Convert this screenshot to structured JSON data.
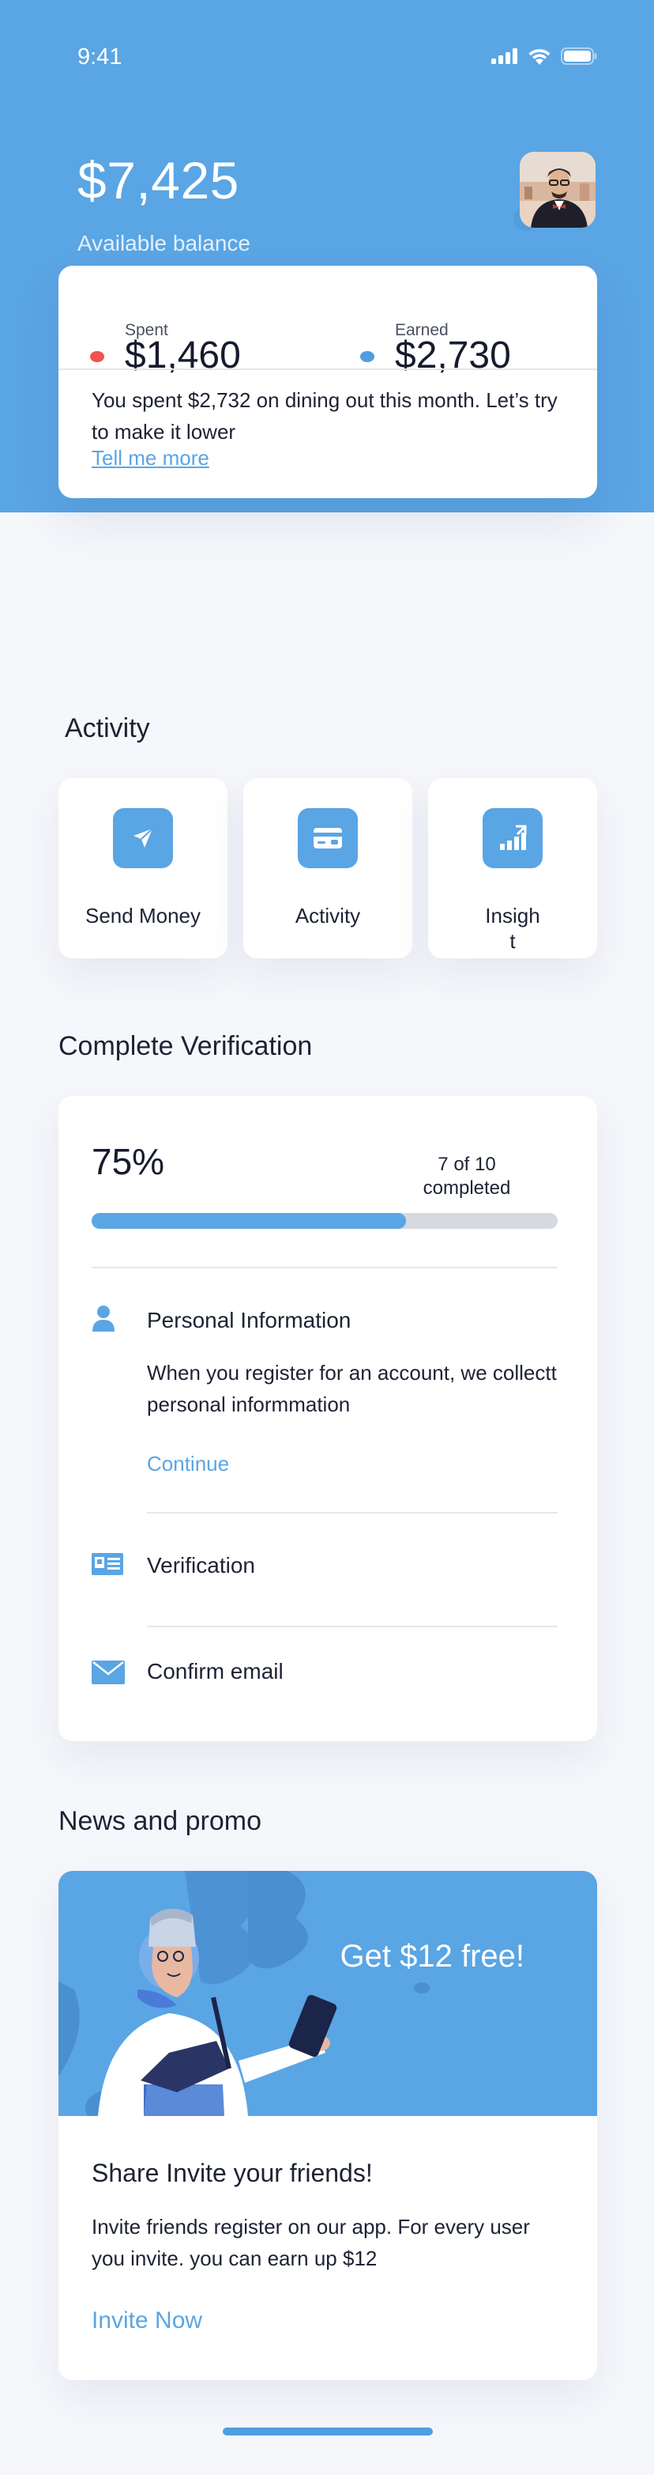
{
  "status_bar": {
    "time": "9:41"
  },
  "header": {
    "balance": "$7,425",
    "balance_label": "Available balance"
  },
  "summary": {
    "spent_label": "Spent",
    "spent_amount": "$1,460",
    "earned_label": "Earned",
    "earned_amount": "$2,730",
    "message": "You spent $2,732 on dining out this month. Let’s try to make it lower",
    "link": "Tell me more"
  },
  "activity": {
    "title": "Activity",
    "actions": [
      {
        "label": "Send Money",
        "icon": "paper-plane-icon"
      },
      {
        "label": "Activity",
        "icon": "credit-card-icon"
      },
      {
        "label": "Insigh t",
        "icon": "bar-chart-up-icon"
      }
    ]
  },
  "verification": {
    "title": "Complete Verification",
    "percent_label": "75%",
    "progress_fraction": 0.675,
    "count_label": "7 of 10 completed",
    "steps": [
      {
        "title": "Personal Information",
        "icon": "user-icon",
        "description": "When you register for an account, we collectt personal informmation",
        "link": "Continue"
      },
      {
        "title": "Verification",
        "icon": "id-card-icon"
      },
      {
        "title": "Confirm email",
        "icon": "envelope-icon"
      }
    ]
  },
  "news": {
    "title": "News and promo",
    "banner_text": "Get $12 free!",
    "card_title": "Share Invite your friends!",
    "card_description": "Invite friends register on our app. For every user you invite. you can earn up $12",
    "link": "Invite Now"
  },
  "colors": {
    "accent": "#5aa5e4",
    "spent_dot": "#f0524d",
    "earned_dot": "#4f9ee0",
    "background": "#f6f7fb"
  }
}
